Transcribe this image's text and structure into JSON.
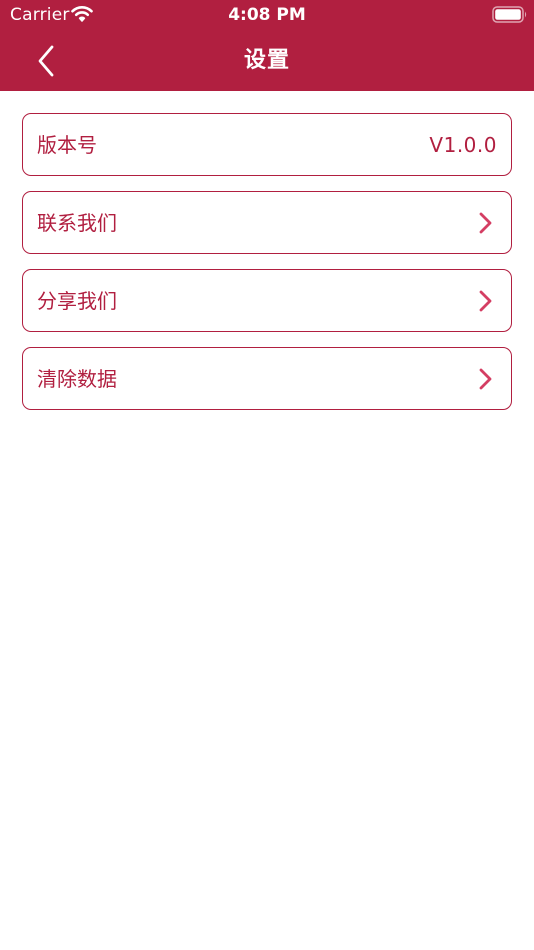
{
  "status_bar": {
    "carrier": "Carrier",
    "time": "4:08 PM"
  },
  "navbar": {
    "title": "设置",
    "back_icon": "chevron-left-icon"
  },
  "settings": {
    "items": [
      {
        "label": "版本号",
        "value": "V1.0.0"
      },
      {
        "label": "联系我们",
        "icon": "chevron-right-icon"
      },
      {
        "label": "分享我们",
        "icon": "chevron-right-icon"
      },
      {
        "label": "清除数据",
        "icon": "chevron-right-icon"
      }
    ]
  },
  "colors": {
    "brand": "#b11f40",
    "chevron": "#d43e63",
    "background": "#ffffff"
  }
}
